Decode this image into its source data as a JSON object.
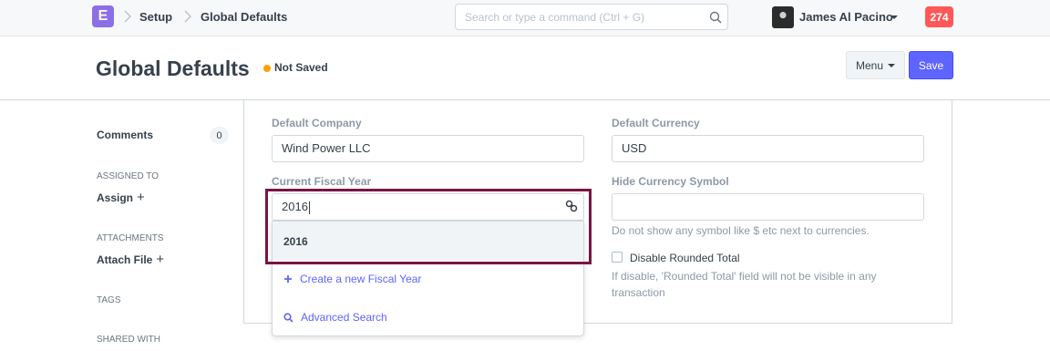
{
  "navbar": {
    "logo": "E",
    "breadcrumbs": [
      "Setup",
      "Global Defaults"
    ],
    "search_placeholder": "Search or type a command (Ctrl + G)",
    "user_name": "James Al Pacino",
    "notification_count": "274"
  },
  "page": {
    "title": "Global Defaults",
    "status": "Not Saved",
    "menu_label": "Menu",
    "save_label": "Save"
  },
  "sidebar": {
    "comments_label": "Comments",
    "comments_count": "0",
    "assigned_to": "ASSIGNED TO",
    "assign": "Assign",
    "attachments": "ATTACHMENTS",
    "attach_file": "Attach File",
    "tags": "TAGS",
    "shared_with": "SHARED WITH"
  },
  "form": {
    "default_company_label": "Default Company",
    "default_company_value": "Wind Power LLC",
    "current_fiscal_year_label": "Current Fiscal Year",
    "current_fiscal_year_value": "2016",
    "default_currency_label": "Default Currency",
    "default_currency_value": "USD",
    "hide_currency_symbol_label": "Hide Currency Symbol",
    "hide_currency_symbol_help": "Do not show any symbol like $ etc next to currencies.",
    "disable_rounded_total_label": "Disable Rounded Total",
    "disable_rounded_total_help": "If disable, 'Rounded Total' field will not be visible in any transaction"
  },
  "dropdown": {
    "selected": "2016",
    "create_new": "Create a new Fiscal Year",
    "advanced_search": "Advanced Search"
  },
  "colors": {
    "primary": "#5e64ff",
    "logo": "#8c6fe6",
    "notification": "#ff5858",
    "status_dot": "#ffa00a",
    "highlight": "#7b1443"
  }
}
